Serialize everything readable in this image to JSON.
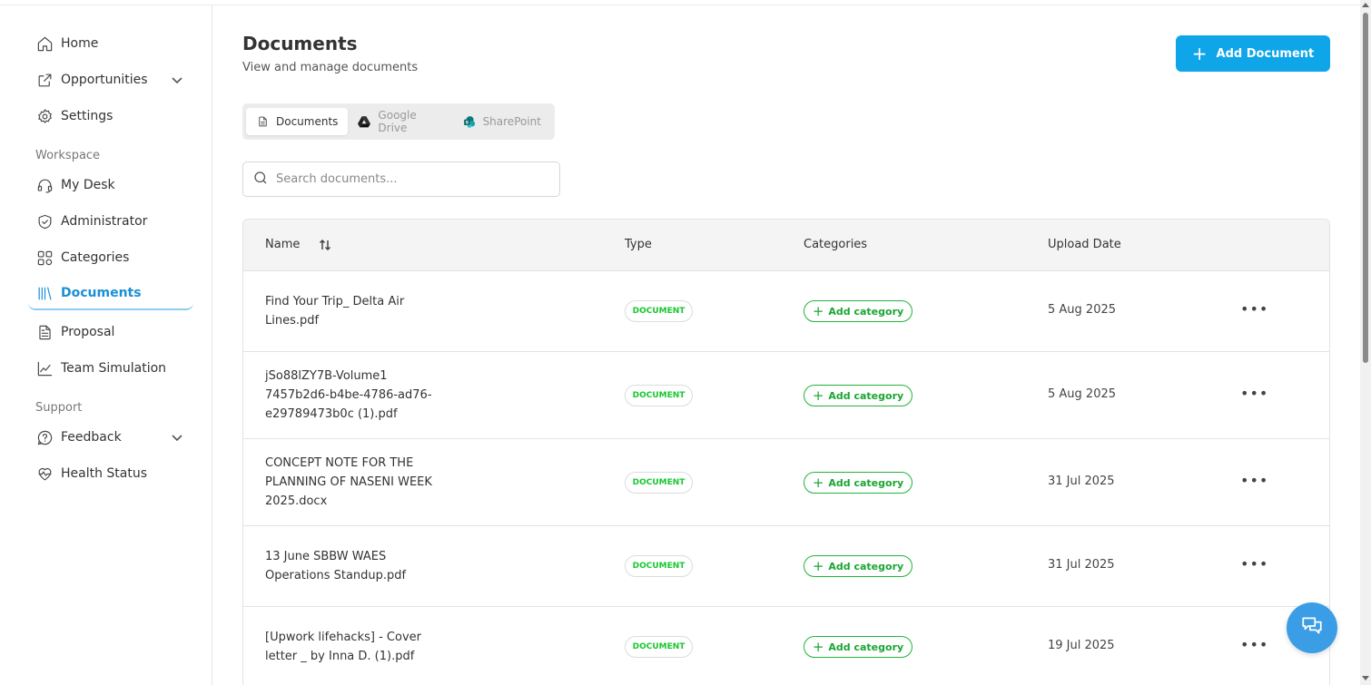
{
  "sidebar": {
    "items_top": [
      {
        "label": "Home",
        "icon": "home-icon"
      },
      {
        "label": "Opportunities",
        "icon": "external-link-icon"
      },
      {
        "label": "Settings",
        "icon": "gear-icon"
      }
    ],
    "workspace_label": "Workspace",
    "items_workspace": [
      {
        "label": "My Desk",
        "icon": "headset-icon"
      },
      {
        "label": "Administrator",
        "icon": "shield-icon"
      },
      {
        "label": "Categories",
        "icon": "categories-icon"
      },
      {
        "label": "Documents",
        "icon": "library-icon"
      },
      {
        "label": "Proposal",
        "icon": "file-text-icon"
      },
      {
        "label": "Team Simulation",
        "icon": "line-chart-icon"
      }
    ],
    "support_label": "Support",
    "items_support": [
      {
        "label": "Feedback",
        "icon": "help-bubble-icon"
      },
      {
        "label": "Health Status",
        "icon": "heart-pulse-icon"
      }
    ]
  },
  "header": {
    "title": "Documents",
    "subtitle": "View and manage documents",
    "add_button_label": "Add Document"
  },
  "tabs": [
    {
      "label": "Documents",
      "active": true,
      "icon": "document-icon"
    },
    {
      "label": "Google Drive",
      "active": false,
      "icon": "google-drive-icon"
    },
    {
      "label": "SharePoint",
      "active": false,
      "icon": "sharepoint-icon"
    }
  ],
  "search": {
    "placeholder": "Search documents..."
  },
  "table": {
    "columns": [
      "Name",
      "Type",
      "Categories",
      "Upload Date"
    ],
    "rows": [
      {
        "name_lines": [
          "Find Your Trip_ Delta Air",
          "Lines.pdf"
        ],
        "type": "DOCUMENT",
        "category": "Add category",
        "date": "5 Aug 2025"
      },
      {
        "name_lines": [
          "jSo88lZY7B-Volume1",
          "7457b2d6-b4be-4786-ad76-",
          "e29789473b0c (1).pdf"
        ],
        "type": "DOCUMENT",
        "category": "Add category",
        "date": "5 Aug 2025"
      },
      {
        "name_lines": [
          "CONCEPT NOTE FOR THE",
          "PLANNING OF NASENI WEEK",
          "2025.docx"
        ],
        "type": "DOCUMENT",
        "category": "Add category",
        "date": "31 Jul 2025"
      },
      {
        "name_lines": [
          "13 June SBBW WAES",
          "Operations Standup.pdf"
        ],
        "type": "DOCUMENT",
        "category": "Add category",
        "date": "31 Jul 2025"
      },
      {
        "name_lines": [
          "[Upwork lifehacks] - Cover",
          "letter _ by Inna D. (1).pdf"
        ],
        "type": "DOCUMENT",
        "category": "Add category",
        "date": "19 Jul 2025"
      }
    ],
    "row_actions_icon": "more-horizontal-icon"
  },
  "colors": {
    "accent": "#0ea5e9",
    "active_nav": "#1a8fd6",
    "badge_green": "#16c72e"
  }
}
